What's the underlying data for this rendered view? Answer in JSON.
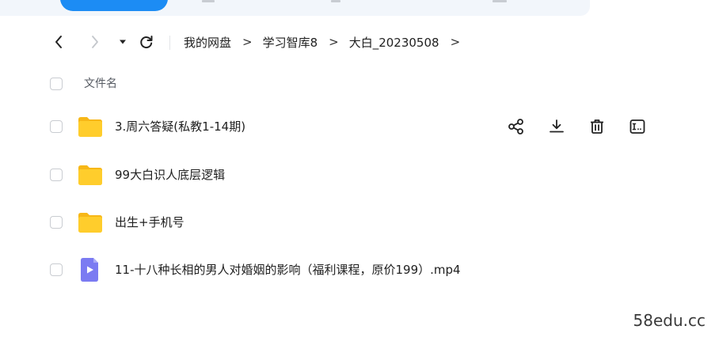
{
  "nav": {
    "back_icon": "chevron-left-icon",
    "forward_icon": "chevron-right-icon",
    "dropdown_icon": "caret-down-icon",
    "refresh_icon": "refresh-icon",
    "breadcrumb": [
      {
        "label": "我的网盘"
      },
      {
        "label": "学习智库8"
      },
      {
        "label": "大白_20230508"
      }
    ],
    "separator": ">"
  },
  "list": {
    "header_name": "文件名",
    "rows": [
      {
        "name": "3.周六答疑(私教1-14期)",
        "type": "folder"
      },
      {
        "name": "99大白识人底层逻辑",
        "type": "folder"
      },
      {
        "name": "出生+手机号",
        "type": "folder"
      },
      {
        "name": "11-十八种长相的男人对婚姻的影响（福利课程，原价199）.mp4",
        "type": "video"
      }
    ],
    "row_actions": [
      "share-icon",
      "download-icon",
      "delete-icon",
      "rename-icon"
    ]
  },
  "colors": {
    "accent": "#1c8cf4",
    "folder": "#ffcd2c",
    "folder_tab": "#f7b717",
    "video": "#7b7bf2"
  },
  "watermark": "58edu.cc"
}
